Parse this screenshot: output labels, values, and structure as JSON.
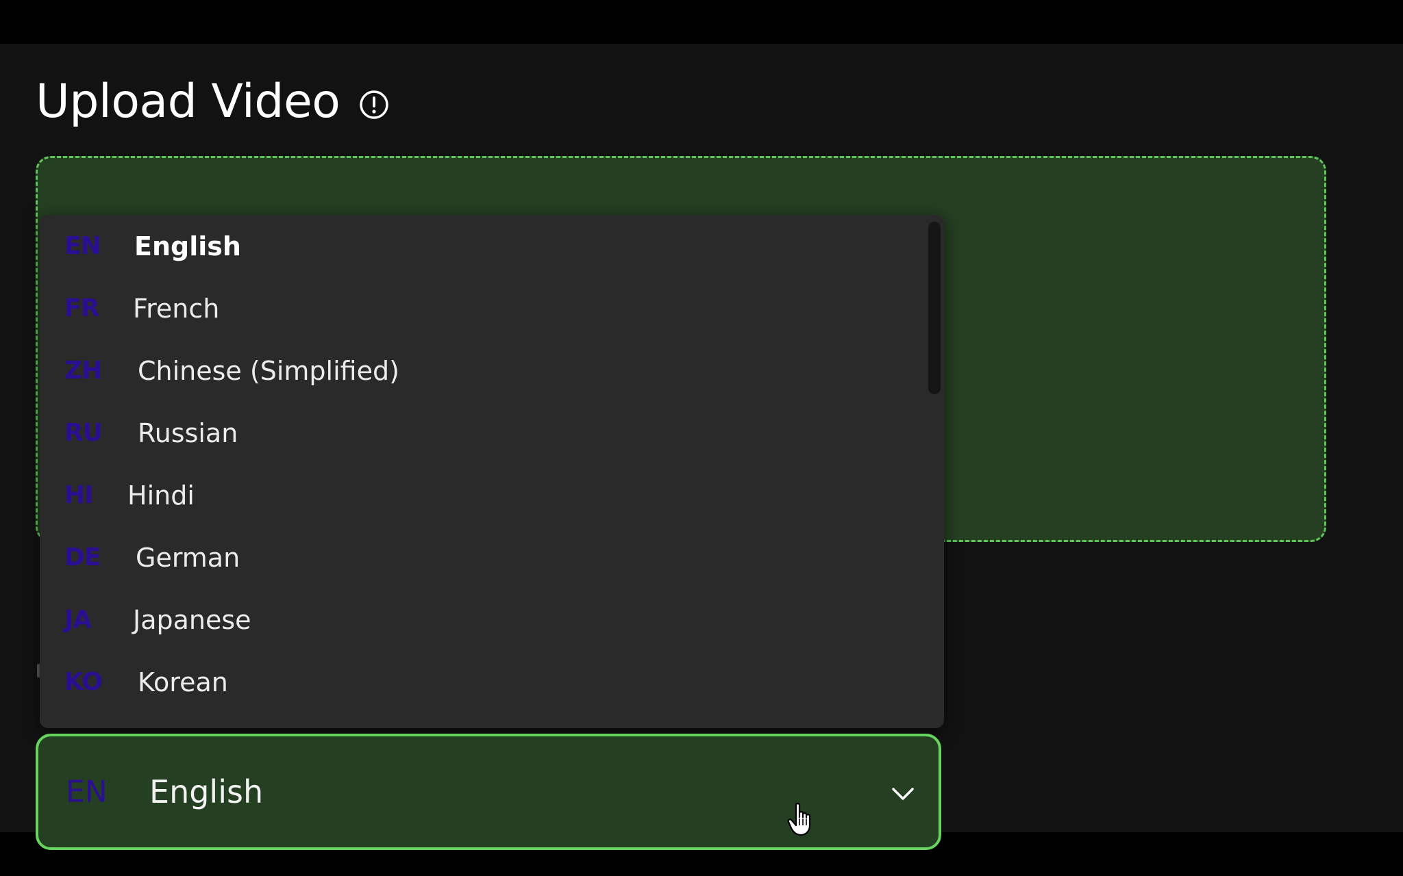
{
  "header": {
    "title": "Upload Video",
    "info_icon": "info-circle-icon"
  },
  "language_menu": {
    "items": [
      {
        "code": "EN",
        "name": "English",
        "selected": true
      },
      {
        "code": "FR",
        "name": "French"
      },
      {
        "code": "ZH",
        "name": "Chinese (Simplified)"
      },
      {
        "code": "RU",
        "name": "Russian"
      },
      {
        "code": "HI",
        "name": "Hindi"
      },
      {
        "code": "DE",
        "name": "German"
      },
      {
        "code": "JA",
        "name": "Japanese"
      },
      {
        "code": "KO",
        "name": "Korean"
      }
    ]
  },
  "language_select": {
    "code": "EN",
    "value": "English",
    "icon": "chevron-down-icon"
  },
  "colors": {
    "accent_green": "#66d45f",
    "panel_green": "#243f22",
    "code_purple": "#2b0f93",
    "menu_bg": "#2a2a2b",
    "app_bg": "#121212"
  }
}
